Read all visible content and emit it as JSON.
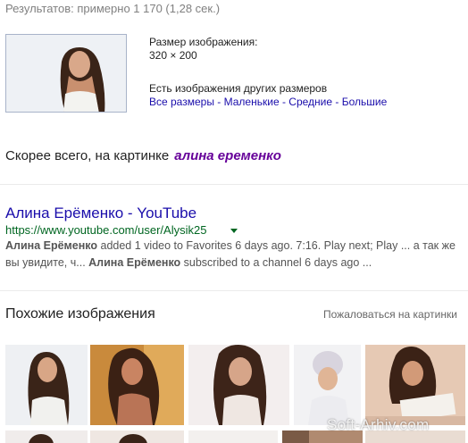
{
  "stats": {
    "text": "Результатов: примерно 1 170 (1,28 сек.)"
  },
  "image_info": {
    "size_label": "Размер изображения:",
    "size_value": "320 × 200",
    "other_sizes_label": "Есть изображения других размеров",
    "links": [
      {
        "label": "Все размеры"
      },
      {
        "label": "Маленькие"
      },
      {
        "label": "Средние"
      },
      {
        "label": "Большие"
      }
    ],
    "separator": " - "
  },
  "best_guess": {
    "prefix": "Скорее всего, на картинке",
    "query": "алина еременко"
  },
  "result": {
    "title": "Алина Ерёменко - YouTube",
    "url": "https://www.youtube.com/user/Alysik25",
    "snippet_b1": "Алина Ерёменко",
    "snippet_t1": " added 1 video to Favorites 6 days ago. 7:16. Play next; Play ... а так же вы увидите, ч... ",
    "snippet_b2": "Алина Ерёменко",
    "snippet_t2": " subscribed to a channel 6 days ago ..."
  },
  "similar": {
    "title": "Похожие изображения",
    "report_link": "Пожаловаться на картинки"
  },
  "watermark": "Soft-Arhiv.com",
  "colors": {
    "link": "#1a0dab",
    "visited": "#660099",
    "url_green": "#006621",
    "snippet": "#545454"
  }
}
